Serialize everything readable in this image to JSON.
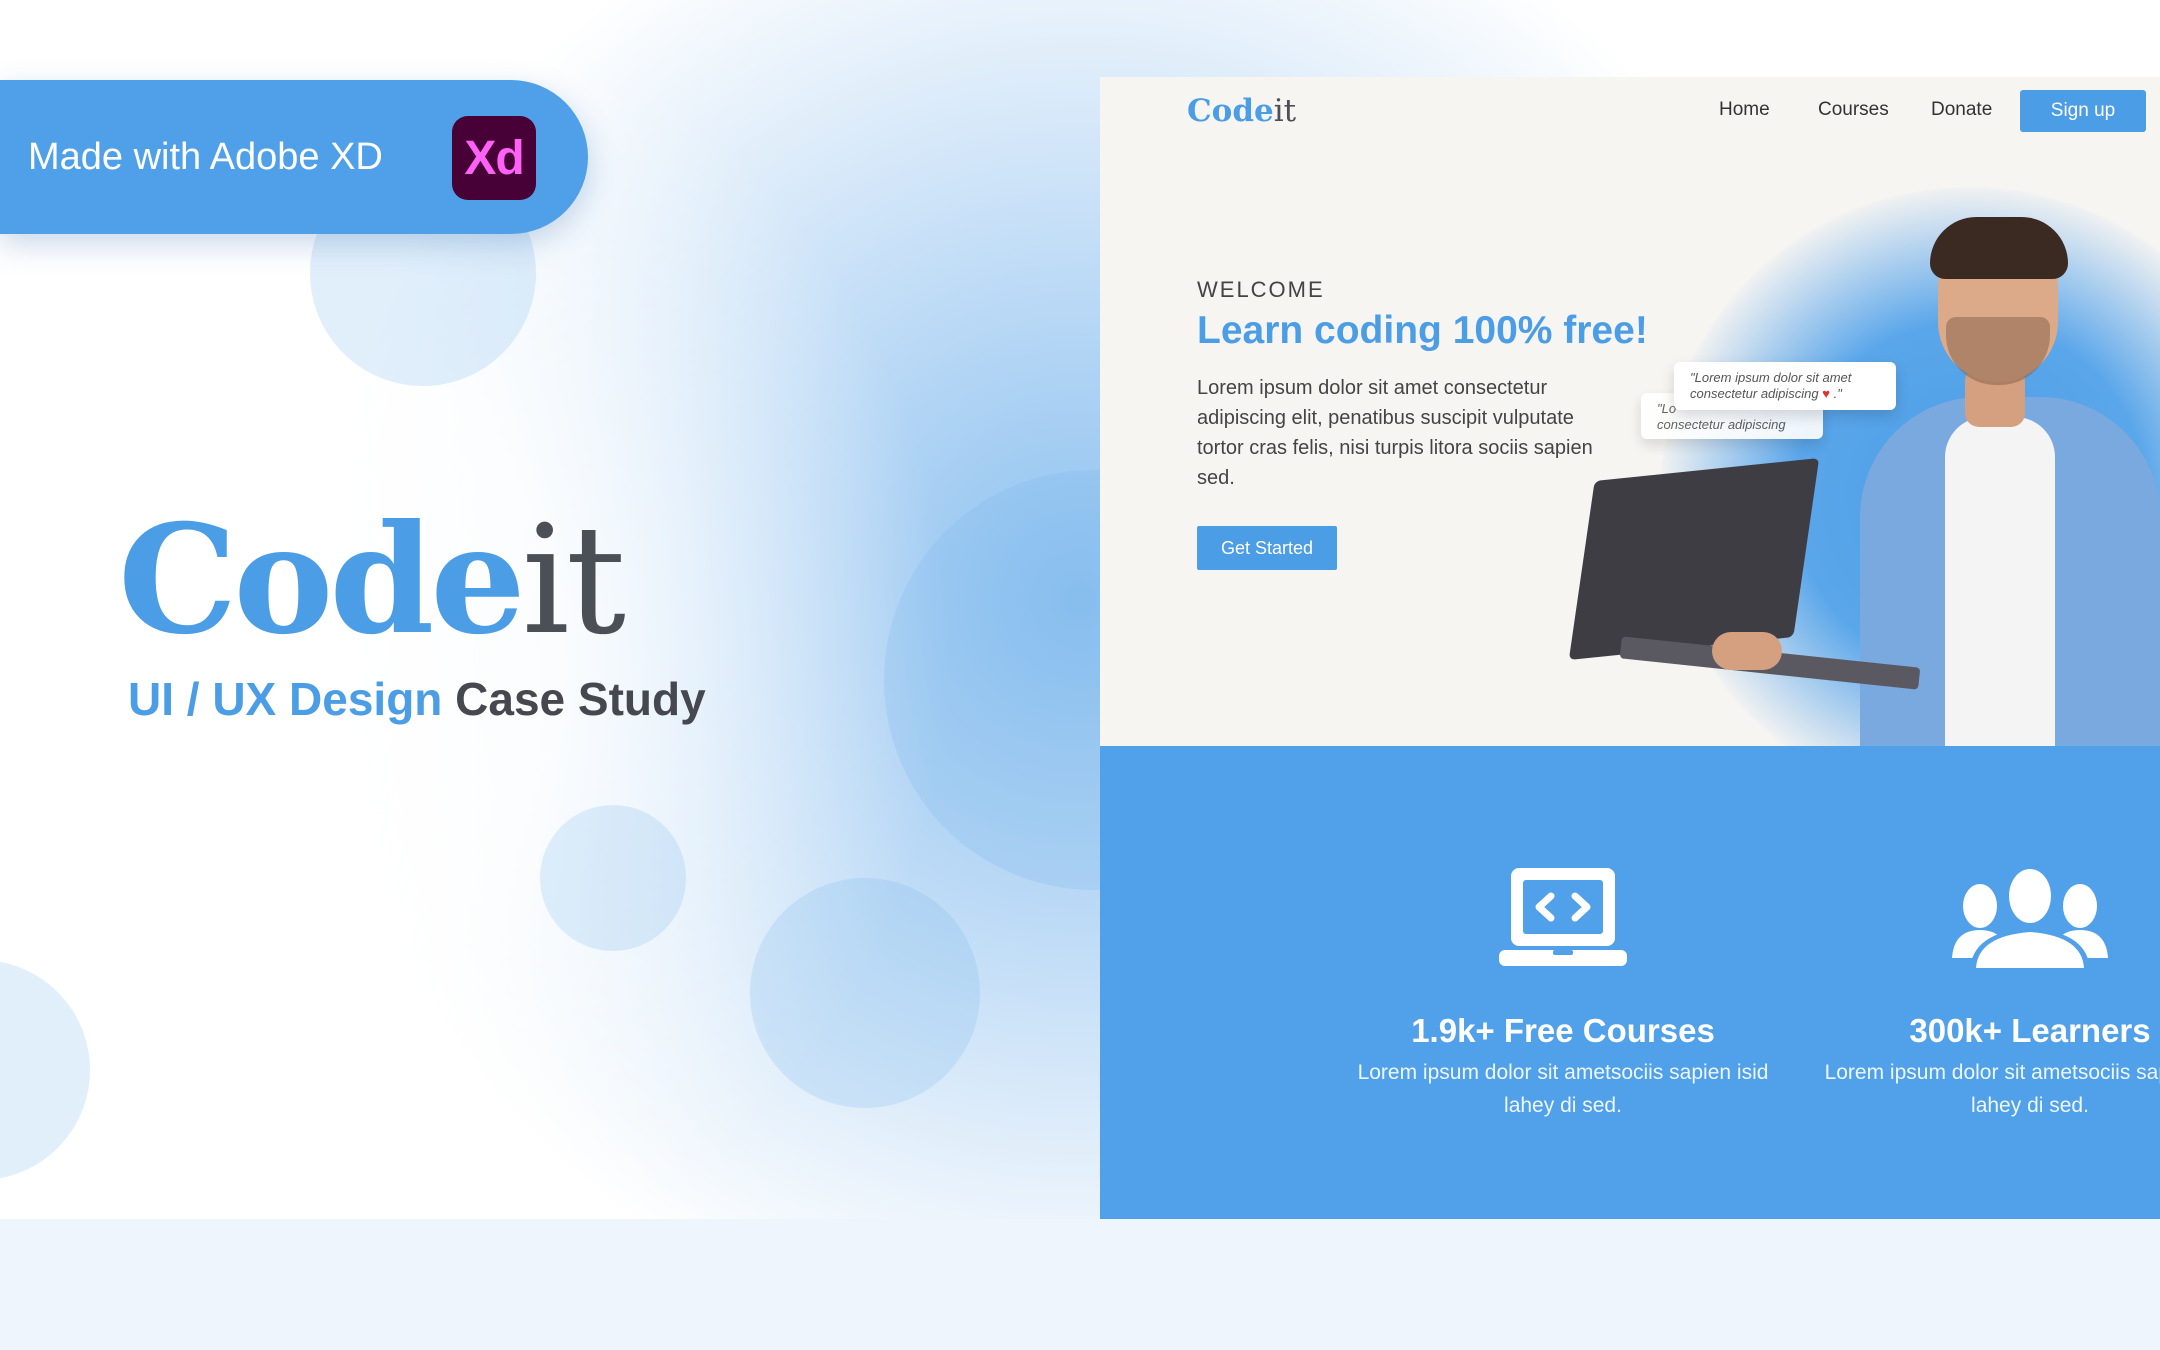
{
  "badge": {
    "text": "Made with Adobe XD",
    "logo_text": "Xd"
  },
  "brand": {
    "code": "Code",
    "it": "it"
  },
  "subtitle": {
    "highlight": "UI / UX Design",
    "rest": "Case Study"
  },
  "mockup": {
    "nav": {
      "logo_code": "Code",
      "logo_it": "it",
      "links": [
        "Home",
        "Courses",
        "Donate"
      ],
      "signup": "Sign up"
    },
    "hero": {
      "eyebrow": "WELCOME",
      "headline": "Learn coding 100% free!",
      "body": "Lorem ipsum dolor sit amet consectetur adipiscing elit, penatibus suscipit vulputate tortor cras felis, nisi turpis litora sociis sapien sed.",
      "cta": "Get Started",
      "chat_front_line1": "\"Lorem ipsum dolor sit amet",
      "chat_front_line2": "consectetur adipiscing",
      "chat_back_line1": "\"Lo",
      "chat_back_line2": "consectetur adipiscing"
    },
    "stats": [
      {
        "title": "1.9k+ Free Courses",
        "desc": "Lorem ipsum dolor sit ametsociis sapien isid lahey di sed.",
        "icon": "laptop-code-icon"
      },
      {
        "title": "300k+ Learners",
        "desc": "Lorem ipsum dolor sit ametsociis sapien isid lahey di sed.",
        "icon": "users-group-icon"
      }
    ]
  },
  "colors": {
    "accent": "#4b9de6",
    "xd_bg": "#470137",
    "xd_fg": "#ff61f6",
    "dark_text": "#45484e"
  }
}
